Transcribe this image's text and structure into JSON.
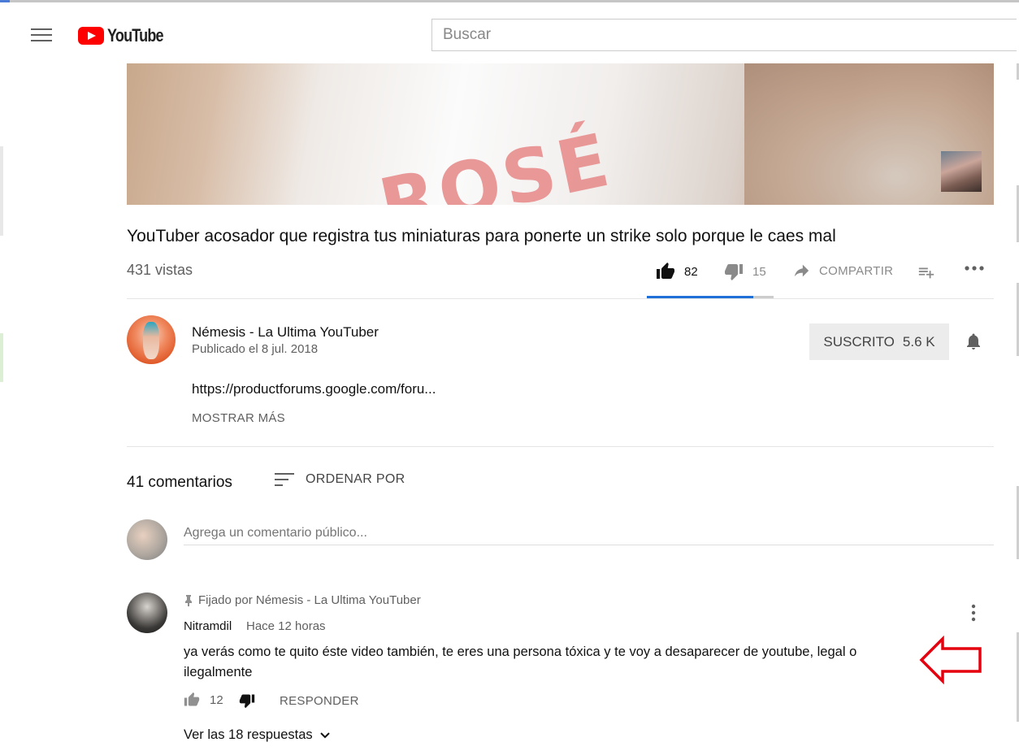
{
  "header": {
    "logo_text": "YouTube",
    "search_placeholder": "Buscar"
  },
  "video": {
    "title": "YouTuber acosador que registra tus miniaturas para ponerte un strike solo porque le caes mal",
    "views": "431 vistas",
    "likes": "82",
    "dislikes": "15",
    "share_label": "COMPARTIR",
    "like_ratio": 0.84
  },
  "channel": {
    "name": "Némesis - La Ultima YouTuber",
    "published": "Publicado el 8 jul. 2018",
    "subscribe_label": "SUSCRITO",
    "subscriber_count": "5.6 K",
    "description_link": "https://productforums.google.com/foru...",
    "show_more": "MOSTRAR MÁS"
  },
  "comments": {
    "count": "41 comentarios",
    "sort_label": "ORDENAR POR",
    "add_placeholder": "Agrega un comentario público...",
    "pinned_comment": {
      "pinned_label": "Fijado por Némesis - La Ultima YouTuber",
      "author": "Nitramdil",
      "time": "Hace 12 horas",
      "text": "ya verás como te quito éste video también, te eres una persona tóxica y te voy a desaparecer de youtube, legal o ilegalmente",
      "likes": "12",
      "reply_label": "RESPONDER",
      "view_replies": "Ver las 18 respuestas"
    }
  },
  "colors": {
    "brand_red": "#ff0000",
    "like_bar": "#1e6fd8",
    "annotation": "#e5000f"
  }
}
